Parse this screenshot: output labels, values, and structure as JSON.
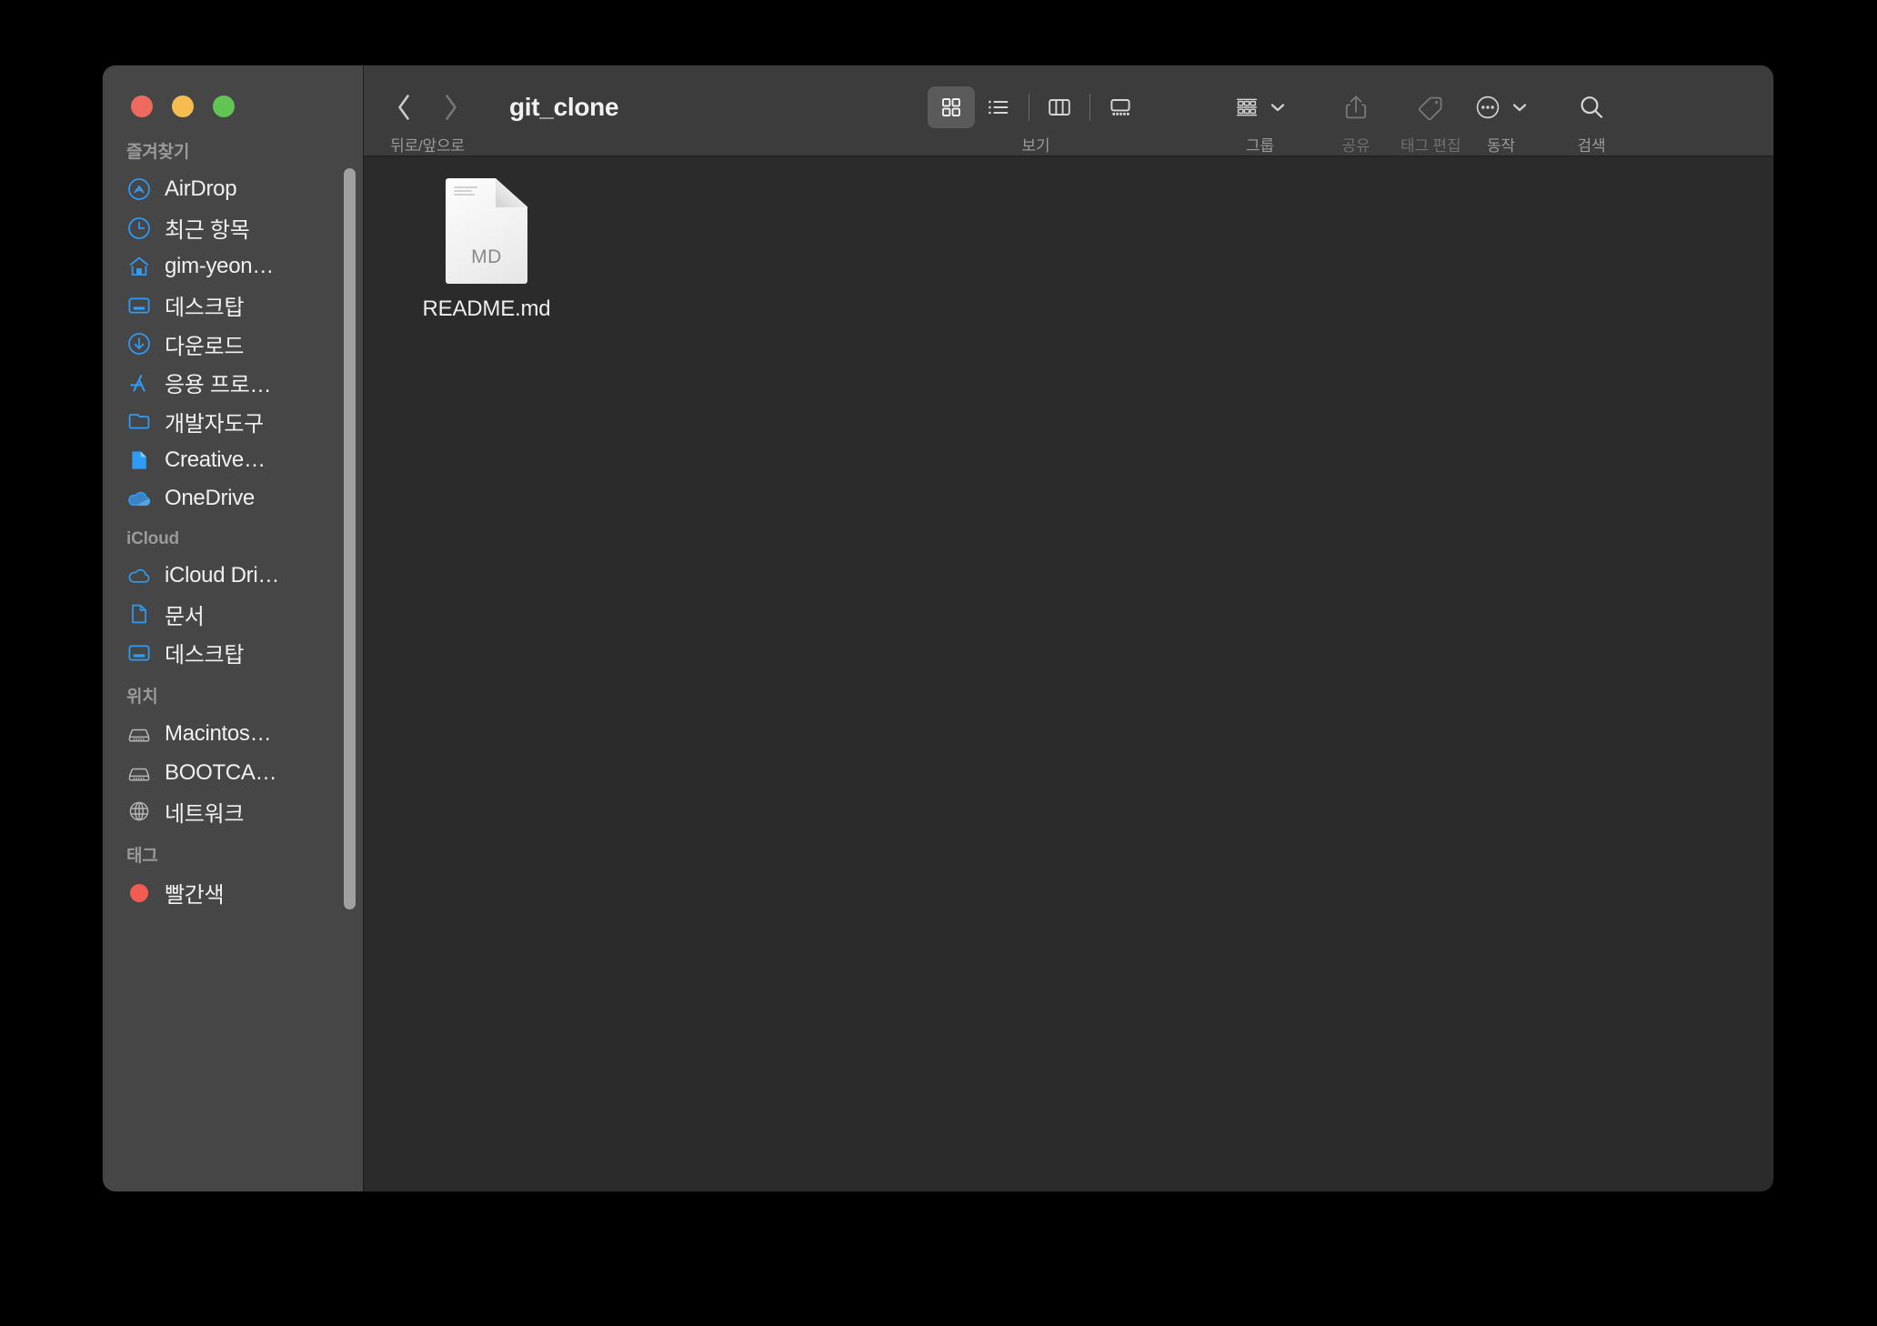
{
  "window": {
    "title": "git_clone",
    "traffic_lights": [
      {
        "name": "close",
        "color": "#ec6a5e"
      },
      {
        "name": "minimize",
        "color": "#f5bd4f"
      },
      {
        "name": "maximize",
        "color": "#61c454"
      }
    ]
  },
  "toolbar": {
    "nav_caption": "뒤로/앞으로",
    "back_icon": "chevron-left-icon",
    "forward_icon": "chevron-right-icon",
    "view_caption": "보기",
    "view_modes": [
      {
        "id": "icon",
        "icon": "grid-view-icon",
        "active": true
      },
      {
        "id": "list",
        "icon": "list-view-icon",
        "active": false
      },
      {
        "id": "column",
        "icon": "column-view-icon",
        "active": false
      },
      {
        "id": "gallery",
        "icon": "gallery-view-icon",
        "active": false
      }
    ],
    "group_caption": "그룹",
    "group_icon": "group-by-icon",
    "share_caption": "공유",
    "share_icon": "share-icon",
    "share_disabled": true,
    "tag_caption": "태그 편집",
    "tag_icon": "tag-icon",
    "tag_disabled": true,
    "action_caption": "동작",
    "action_icon": "ellipsis-circle-icon",
    "search_caption": "검색",
    "search_icon": "search-icon"
  },
  "sidebar": {
    "sections": [
      {
        "title": "즐겨찾기",
        "items": [
          {
            "label": "AirDrop",
            "icon": "airdrop-icon"
          },
          {
            "label": "최근 항목",
            "icon": "clock-icon"
          },
          {
            "label": "gim-yeon…",
            "icon": "home-icon"
          },
          {
            "label": "데스크탑",
            "icon": "desktop-icon"
          },
          {
            "label": "다운로드",
            "icon": "download-icon"
          },
          {
            "label": "응용 프로…",
            "icon": "applications-icon"
          },
          {
            "label": "개발자도구",
            "icon": "folder-icon"
          },
          {
            "label": "Creative…",
            "icon": "document-icon"
          },
          {
            "label": "OneDrive",
            "icon": "onedrive-cloud-icon"
          }
        ]
      },
      {
        "title": "iCloud",
        "items": [
          {
            "label": "iCloud Dri…",
            "icon": "icloud-icon"
          },
          {
            "label": "문서",
            "icon": "documents-icon"
          },
          {
            "label": "데스크탑",
            "icon": "desktop-icon"
          }
        ]
      },
      {
        "title": "위치",
        "items": [
          {
            "label": "Macintos…",
            "icon": "harddisk-icon"
          },
          {
            "label": "BOOTCA…",
            "icon": "harddisk-icon"
          },
          {
            "label": "네트워크",
            "icon": "network-globe-icon"
          }
        ]
      },
      {
        "title": "태그",
        "items": [
          {
            "label": "빨간색",
            "icon": "tag-dot-icon",
            "dot_color": "#f05b52"
          }
        ]
      }
    ]
  },
  "content": {
    "files": [
      {
        "name": "README.md",
        "ext": "MD",
        "icon": "markdown-document-icon"
      }
    ]
  }
}
